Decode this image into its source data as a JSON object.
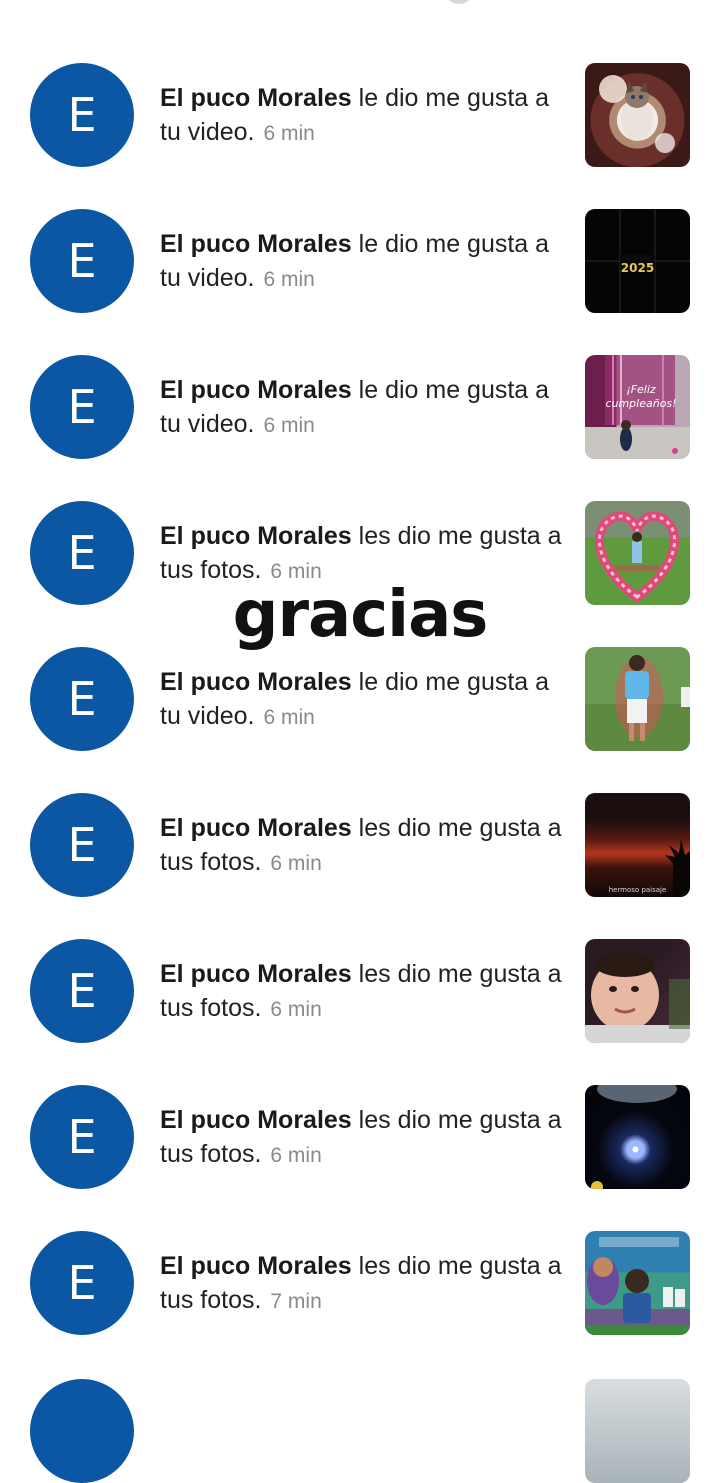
{
  "notifications": [
    {
      "avatar_letter": "E",
      "name": "El puco Morales",
      "action": "le dio me gusta a tu video.",
      "time": "6 min",
      "thumb_icon": "cat-photo"
    },
    {
      "avatar_letter": "E",
      "name": "El puco Morales",
      "action": "le dio me gusta a tu video.",
      "time": "6 min",
      "thumb_icon": "2025-video",
      "thumb_caption": "2025"
    },
    {
      "avatar_letter": "E",
      "name": "El puco Morales",
      "action": "le dio me gusta a tu video.",
      "time": "6 min",
      "thumb_icon": "birthday-photo",
      "thumb_caption": "¡Feliz cumpleaños!"
    },
    {
      "avatar_letter": "E",
      "name": "El puco Morales",
      "action": "les dio me gusta a tus fotos.",
      "time": "6 min",
      "thumb_icon": "heart-arch-photo"
    },
    {
      "avatar_letter": "E",
      "name": "El puco Morales",
      "action": "le dio me gusta a tu video.",
      "time": "6 min",
      "thumb_icon": "child-garden-photo"
    },
    {
      "avatar_letter": "E",
      "name": "El puco Morales",
      "action": "les dio me gusta a tus fotos.",
      "time": "6 min",
      "thumb_icon": "sunset-photo",
      "thumb_caption": "hermoso paisaje"
    },
    {
      "avatar_letter": "E",
      "name": "El puco Morales",
      "action": "les dio me gusta a tus fotos.",
      "time": "6 min",
      "thumb_icon": "baby-photo"
    },
    {
      "avatar_letter": "E",
      "name": "El puco Morales",
      "action": "les dio me gusta a tus fotos.",
      "time": "6 min",
      "thumb_icon": "night-light-photo"
    },
    {
      "avatar_letter": "E",
      "name": "El puco Morales",
      "action": "les dio me gusta a tus fotos.",
      "time": "7 min",
      "thumb_icon": "party-photo"
    }
  ],
  "overlay_text": "gracias",
  "colors": {
    "avatar": "#0b57a4",
    "name": "#1a1a1a",
    "time": "#8a8a8a"
  }
}
